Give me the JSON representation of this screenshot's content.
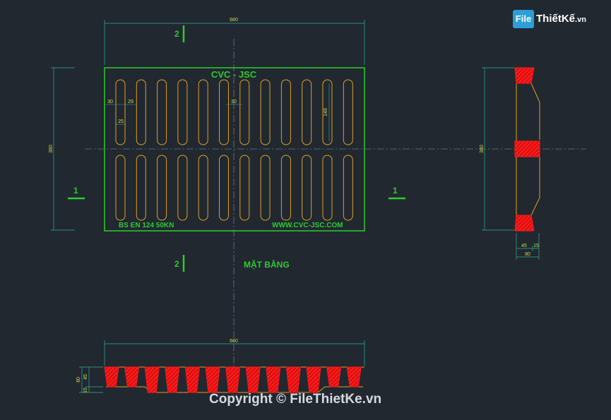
{
  "logo": {
    "brand": "File",
    "name": "ThiếtKế",
    "domain": ".vn"
  },
  "plan": {
    "brand": "CVC - JSC",
    "standard": "BS EN 124 50KN",
    "website": "WWW.CVC-JSC.COM",
    "title": "MẶT BẰNG"
  },
  "section_marks": {
    "two": "2",
    "one": "1"
  },
  "dimensions": {
    "top_width": "680",
    "bottom_width": "680",
    "left_height": "380",
    "right_height": "380",
    "slot_pitch_a": "30",
    "slot_gap": "29",
    "slot_pitch_b": "30",
    "slot_width": "25",
    "slot_length": "148",
    "side_45": "45",
    "side_15": "15",
    "side_80": "80",
    "bottom_80": "80",
    "bottom_45": "45",
    "bottom_15": "15"
  },
  "colors": {
    "background": "#212830",
    "outline": "#2ecc2e",
    "slot": "#e0a028",
    "hatch": "#ff1a1a",
    "dim": "#2fae9c",
    "dimtext": "#d6d64a"
  },
  "copyright": "Copyright © FileThietKe.vn"
}
